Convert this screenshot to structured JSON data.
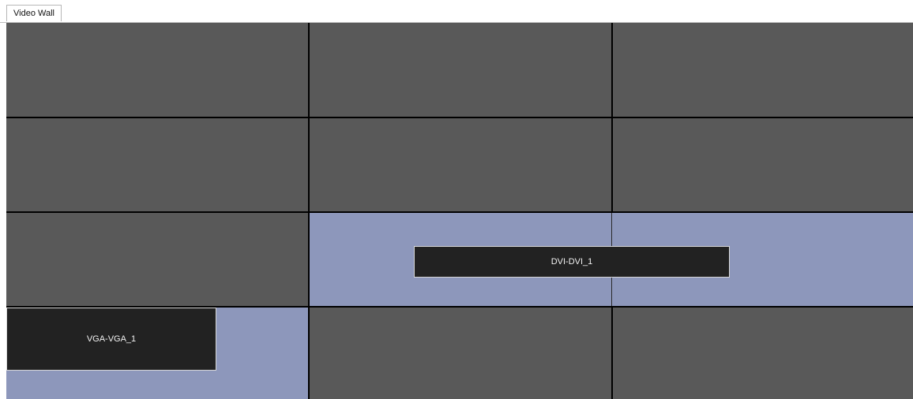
{
  "tabs": [
    {
      "label": "Video Wall"
    }
  ],
  "wall": {
    "rows": 4,
    "columns": 3,
    "windows": [
      {
        "label": "DVI-DVI_1"
      },
      {
        "label": "VGA-VGA_1"
      }
    ]
  },
  "colors": {
    "screen_idle": "#595959",
    "screen_assigned": "#8d97bb",
    "window_fill": "#222222",
    "window_border": "#d7d7d7",
    "grid_line": "#000000"
  }
}
